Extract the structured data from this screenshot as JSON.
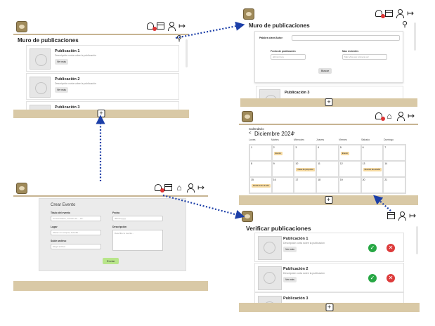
{
  "panel_feed": {
    "title": "Muro de publicaciones",
    "posts": [
      {
        "title": "Publicación 1",
        "desc": "Descripción corta sobre la publicación",
        "button": "Ver más"
      },
      {
        "title": "Publicación 2",
        "desc": "Descripción corta sobre la publicación",
        "button": "Ver más"
      },
      {
        "title": "Publicación 3"
      }
    ]
  },
  "panel_search": {
    "title": "Muro de publicaciones",
    "keyword_label": "Palabra clave/Autor:",
    "date_label": "Fecha de publicación",
    "date_placeholder": "dd/mm/yyyy",
    "sort_label": "Mas recientes",
    "sort_placeholder": "Más Vista por primera vez",
    "search_button": "Buscar",
    "partial_post": "Publicación 3"
  },
  "panel_calendar": {
    "section": "Calendario",
    "month": "Diciembre 2024",
    "days_of_week": [
      "Lunes",
      "Martes",
      "Miércoles",
      "Jueves",
      "Viernes",
      "Sábado",
      "Domingo"
    ],
    "weeks": [
      [
        "1",
        "2",
        "3",
        "4",
        "5",
        "6",
        "7"
      ],
      [
        "8",
        "9",
        "10",
        "11",
        "12",
        "13",
        "14"
      ],
      [
        "15",
        "16",
        "17",
        "18",
        "19",
        "20",
        "21"
      ]
    ],
    "events": {
      "2": "Evento",
      "5": "Evento",
      "10": "Clase de proyectos",
      "13": "Reunión de estudio",
      "15": "Fiesta de fin de año"
    }
  },
  "panel_event": {
    "title": "Crear Evento",
    "title_label": "Título del evento",
    "title_placeholder": "Conversatorio, reunión de..., etc.",
    "date_label": "Fecha",
    "date_placeholder": "dd/mm/yyyy",
    "place_label": "Lugar",
    "place_placeholder": "Ubicar en campus, Aula 8A...",
    "desc_label": "Descripción",
    "desc_placeholder": "Describe tu evento...",
    "file_label": "Subir archivo",
    "file_placeholder": "Elegir archivo",
    "send_button": "Enviar"
  },
  "panel_verify": {
    "title": "Verificar publicaciones",
    "posts": [
      {
        "title": "Publicación 1",
        "desc": "Descripción corta sobre la publicación",
        "button": "Ver más"
      },
      {
        "title": "Publicación 2",
        "desc": "Descripción corta sobre la publicación",
        "button": "Ver más"
      },
      {
        "title": "Publicación 3"
      }
    ]
  },
  "icons": {
    "notification": "bell-icon",
    "calendar": "calendar-icon",
    "home": "home-icon",
    "profile": "user-icon",
    "logout": "logout-icon",
    "search": "search-icon",
    "add": "plus-icon"
  },
  "colors": {
    "footer": "#d9c9a6",
    "accent_line": "#c7b492",
    "approve": "#27a744",
    "reject": "#dd3b3b",
    "event_tag": "#f5d9a0",
    "send": "#b8e58a"
  }
}
